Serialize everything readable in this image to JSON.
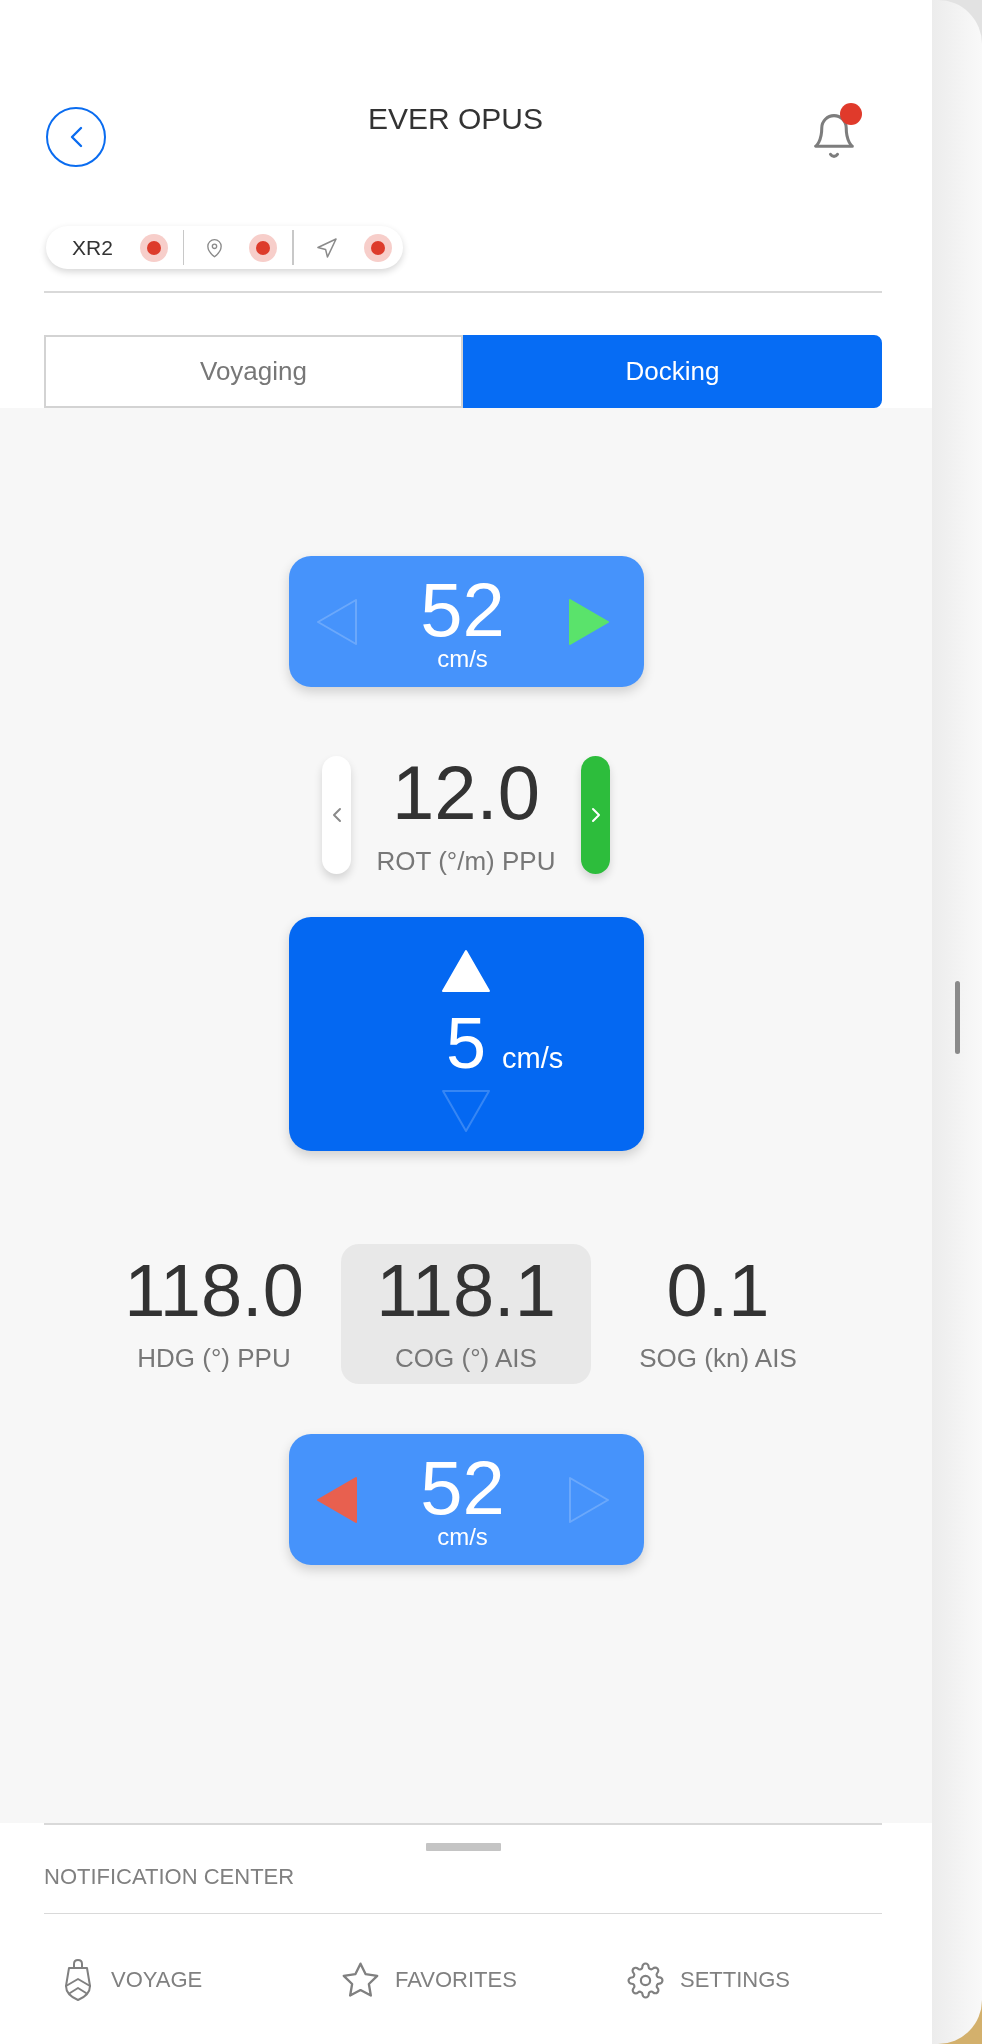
{
  "header": {
    "title": "EVER OPUS",
    "unread_notifications": true
  },
  "status_strip": [
    {
      "kind": "device",
      "label": "XR2",
      "color": "#dd3b2b"
    },
    {
      "kind": "position",
      "color": "#dd3b2b"
    },
    {
      "kind": "heading",
      "color": "#dd3b2b"
    }
  ],
  "tabs": [
    {
      "label": "Voyaging",
      "selected": false
    },
    {
      "label": "Docking",
      "selected": true
    }
  ],
  "docking_panel": [
    {
      "kind": "hspeed",
      "value": "52",
      "unit": "cm/s",
      "left_active": false,
      "right_active": true
    },
    {
      "kind": "rot",
      "value": "12.0",
      "label": "ROT (°/m) PPU",
      "left_active": false,
      "right_active": true
    },
    {
      "kind": "vspeed",
      "value": "5",
      "unit": "cm/s",
      "up_active": true,
      "down_active": false
    },
    {
      "kind": "readouts",
      "items": [
        {
          "value": "118.0",
          "label": "HDG (°) PPU",
          "selected": false
        },
        {
          "value": "118.1",
          "label": "COG (°) AIS",
          "selected": true
        },
        {
          "value": "0.1",
          "label": "SOG (kn) AIS",
          "selected": false
        }
      ]
    },
    {
      "kind": "hspeed",
      "value": "52",
      "unit": "cm/s",
      "left_active": true,
      "right_active": false
    }
  ],
  "notification_center": {
    "title": "NOTIFICATION CENTER"
  },
  "bottom_nav": [
    {
      "kind": "ship",
      "label": "VOYAGE",
      "selected": false
    },
    {
      "kind": "star",
      "label": "FAVORITES",
      "selected": false
    },
    {
      "kind": "gear",
      "label": "SETTINGS",
      "selected": false
    }
  ]
}
